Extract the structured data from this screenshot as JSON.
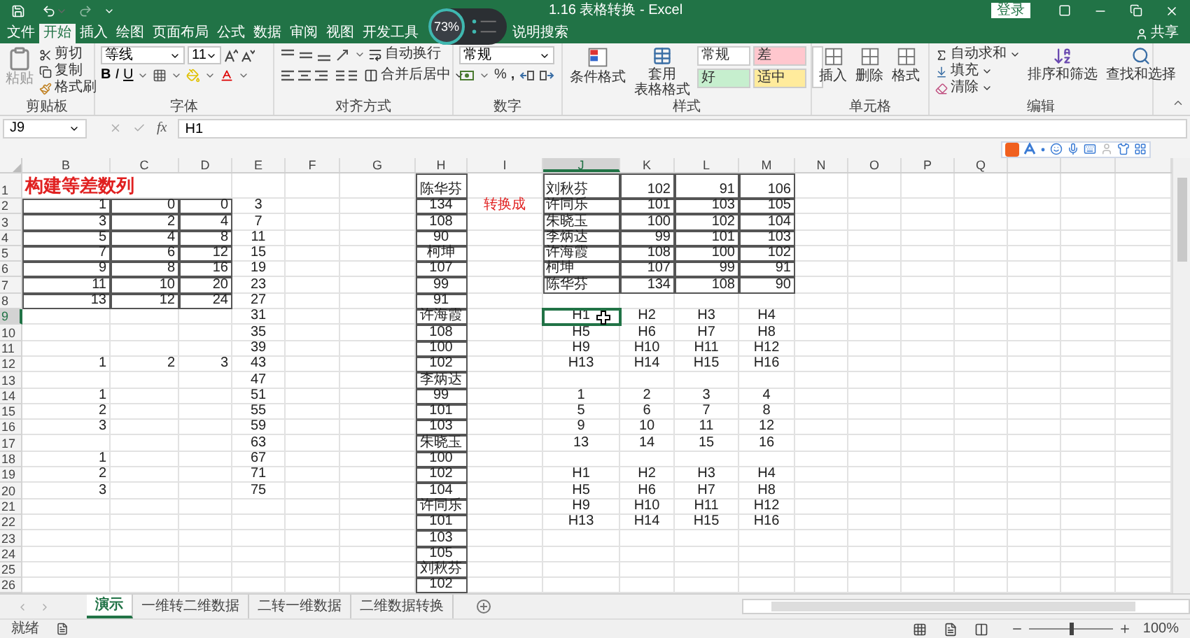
{
  "title_bar": {
    "title": "1.16 表格转换 - Excel",
    "sign_in": "登录"
  },
  "ribbon_tabs": [
    {
      "label": "文件",
      "selected": false
    },
    {
      "label": "开始",
      "selected": true
    },
    {
      "label": "插入",
      "selected": false
    },
    {
      "label": "绘图",
      "selected": false
    },
    {
      "label": "页面布局",
      "selected": false
    },
    {
      "label": "公式",
      "selected": false
    },
    {
      "label": "数据",
      "selected": false
    },
    {
      "label": "审阅",
      "selected": false
    },
    {
      "label": "视图",
      "selected": false
    },
    {
      "label": "开发工具",
      "selected": false
    }
  ],
  "tell_me": "说明搜索",
  "share": "共享",
  "speed_widget": {
    "percent": "73%"
  },
  "ribbon": {
    "clipboard": {
      "label": "剪贴板",
      "paste": "粘贴",
      "cut": "剪切",
      "copy": "复制",
      "format_painter": "格式刷"
    },
    "font": {
      "label": "字体",
      "name": "等线",
      "size": "11",
      "bold": "B",
      "italic": "I",
      "underline": "U"
    },
    "alignment": {
      "label": "对齐方式",
      "wrap": "自动换行",
      "merge": "合并后居中"
    },
    "number": {
      "label": "数字",
      "format": "常规",
      "percent": "%",
      "comma": ","
    },
    "styles": {
      "label": "样式",
      "conditional": "条件格式",
      "table": "套用",
      "table_2": "表格格式",
      "cells": [
        {
          "label": "常规",
          "color": "#ffffff"
        },
        {
          "label": "差",
          "color": "#ffc7ce"
        },
        {
          "label": "好",
          "color": "#c6efce"
        },
        {
          "label": "适中",
          "color": "#ffeb9c"
        }
      ]
    },
    "cells": {
      "label": "单元格",
      "items": [
        "插入",
        "删除",
        "格式"
      ]
    },
    "editing": {
      "label": "编辑",
      "autosum": "自动求和",
      "fill": "填充",
      "clear": "清除",
      "sort": "排序和筛选",
      "find": "查找和选择"
    }
  },
  "formula_bar": {
    "name_box": "J9",
    "function_label": "fx",
    "formula": "H1"
  },
  "grid": {
    "columns": [
      {
        "label": "B",
        "selected": false
      },
      {
        "label": "C",
        "selected": false
      },
      {
        "label": "D",
        "selected": false
      },
      {
        "label": "E",
        "selected": false
      },
      {
        "label": "F",
        "selected": false
      },
      {
        "label": "G",
        "selected": false
      },
      {
        "label": "H",
        "selected": false
      },
      {
        "label": "I",
        "selected": false
      },
      {
        "label": "J",
        "selected": true
      },
      {
        "label": "K",
        "selected": false
      },
      {
        "label": "L",
        "selected": false
      },
      {
        "label": "M",
        "selected": false
      },
      {
        "label": "N",
        "selected": false
      },
      {
        "label": "O",
        "selected": false
      },
      {
        "label": "P",
        "selected": false
      },
      {
        "label": "Q",
        "selected": false
      }
    ],
    "rows": [
      {
        "number": "1",
        "selected": false,
        "cells": {
          "b": {
            "text": "构建等差数列",
            "kind": "title"
          },
          "h": "陈华芬",
          "j": "刘秋芬",
          "k": "102",
          "l": "91",
          "m": "106"
        }
      },
      {
        "number": "2",
        "selected": false,
        "cells": {
          "b": "1",
          "c": "0",
          "d": "0",
          "e": "3",
          "h": "134",
          "i": {
            "text": "转换成",
            "kind": "note"
          },
          "j": "许同乐",
          "k": "101",
          "l": "103",
          "m": "105"
        }
      },
      {
        "number": "3",
        "selected": false,
        "cells": {
          "b": "3",
          "c": "2",
          "d": "4",
          "e": "7",
          "h": "108",
          "j": "朱晓玉",
          "k": "100",
          "l": "102",
          "m": "104"
        }
      },
      {
        "number": "4",
        "selected": false,
        "cells": {
          "b": "5",
          "c": "4",
          "d": "8",
          "e": "11",
          "h": "90",
          "j": "李炳达",
          "k": "99",
          "l": "101",
          "m": "103"
        }
      },
      {
        "number": "5",
        "selected": false,
        "cells": {
          "b": "7",
          "c": "6",
          "d": "12",
          "e": "15",
          "h": "柯坤",
          "j": "许海霞",
          "k": "108",
          "l": "100",
          "m": "102"
        }
      },
      {
        "number": "6",
        "selected": false,
        "cells": {
          "b": "9",
          "c": "8",
          "d": "16",
          "e": "19",
          "h": "107",
          "j": "柯坤",
          "k": "107",
          "l": "99",
          "m": "91"
        }
      },
      {
        "number": "7",
        "selected": false,
        "cells": {
          "b": "11",
          "c": "10",
          "d": "20",
          "e": "23",
          "h": "99",
          "j": "陈华芬",
          "k": "134",
          "l": "108",
          "m": "90"
        }
      },
      {
        "number": "8",
        "selected": false,
        "cells": {
          "b": "13",
          "c": "12",
          "d": "24",
          "e": "27",
          "h": "91"
        }
      },
      {
        "number": "9",
        "selected": true,
        "cells": {
          "e": "31",
          "h": "许海霞",
          "j": "H1",
          "k": "H2",
          "l": "H3",
          "m": "H4"
        }
      },
      {
        "number": "10",
        "selected": false,
        "cells": {
          "e": "35",
          "h": "108",
          "j": "H5",
          "k": "H6",
          "l": "H7",
          "m": "H8"
        }
      },
      {
        "number": "11",
        "selected": false,
        "cells": {
          "e": "39",
          "h": "100",
          "j": "H9",
          "k": "H10",
          "l": "H11",
          "m": "H12"
        }
      },
      {
        "number": "12",
        "selected": false,
        "cells": {
          "b": "1",
          "c": "2",
          "d": "3",
          "e": "43",
          "h": "102",
          "j": "H13",
          "k": "H14",
          "l": "H15",
          "m": "H16"
        }
      },
      {
        "number": "13",
        "selected": false,
        "cells": {
          "e": "47",
          "h": "李炳达"
        }
      },
      {
        "number": "14",
        "selected": false,
        "cells": {
          "b": "1",
          "e": "51",
          "h": "99",
          "j": "1",
          "k": "2",
          "l": "3",
          "m": "4"
        }
      },
      {
        "number": "15",
        "selected": false,
        "cells": {
          "b": "2",
          "e": "55",
          "h": "101",
          "j": "5",
          "k": "6",
          "l": "7",
          "m": "8"
        }
      },
      {
        "number": "16",
        "selected": false,
        "cells": {
          "b": "3",
          "e": "59",
          "h": "103",
          "j": "9",
          "k": "10",
          "l": "11",
          "m": "12"
        }
      },
      {
        "number": "17",
        "selected": false,
        "cells": {
          "e": "63",
          "h": "朱晓玉",
          "j": "13",
          "k": "14",
          "l": "15",
          "m": "16"
        }
      },
      {
        "number": "18",
        "selected": false,
        "cells": {
          "b": "1",
          "e": "67",
          "h": "100"
        }
      },
      {
        "number": "19",
        "selected": false,
        "cells": {
          "b": "2",
          "e": "71",
          "h": "102",
          "j": "H1",
          "k": "H2",
          "l": "H3",
          "m": "H4"
        }
      },
      {
        "number": "20",
        "selected": false,
        "cells": {
          "b": "3",
          "e": "75",
          "h": "104",
          "j": "H5",
          "k": "H6",
          "l": "H7",
          "m": "H8"
        }
      },
      {
        "number": "21",
        "selected": false,
        "cells": {
          "h": "许同乐",
          "j": "H9",
          "k": "H10",
          "l": "H11",
          "m": "H12"
        }
      },
      {
        "number": "22",
        "selected": false,
        "cells": {
          "h": "101",
          "j": "H13",
          "k": "H14",
          "l": "H15",
          "m": "H16"
        }
      },
      {
        "number": "23",
        "selected": false,
        "cells": {
          "h": "103"
        }
      },
      {
        "number": "24",
        "selected": false,
        "cells": {
          "h": "105"
        }
      },
      {
        "number": "25",
        "selected": false,
        "cells": {
          "h": "刘秋芬"
        }
      },
      {
        "number": "26",
        "selected": false,
        "cells": {
          "h": "102"
        }
      }
    ]
  },
  "sheet_tabs": [
    {
      "label": "演示",
      "selected": true
    },
    {
      "label": "一维转二维数据",
      "selected": false
    },
    {
      "label": "二转一维数据",
      "selected": false
    },
    {
      "label": "二维数据转换",
      "selected": false
    }
  ],
  "status_bar": {
    "status": "就绪",
    "zoom": "100%",
    "zoom_slider": {
      "level": 0.5
    }
  }
}
